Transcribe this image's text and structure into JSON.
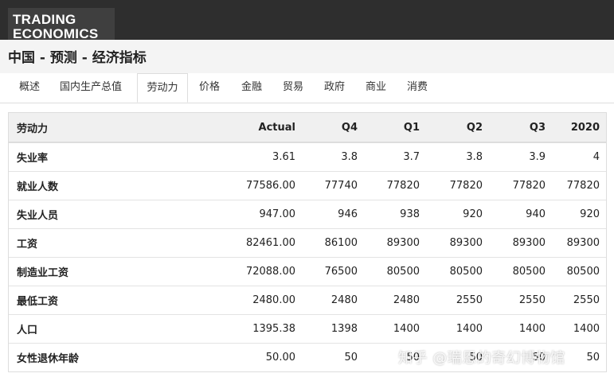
{
  "brand": {
    "line1": "TRADING",
    "line2": "ECONOMICS"
  },
  "page": {
    "title": "中国 - 预测 - 经济指标"
  },
  "tabs": [
    "概述",
    "国内生产总值",
    "劳动力",
    "价格",
    "金融",
    "贸易",
    "政府",
    "商业",
    "消费"
  ],
  "active_tab": "劳动力",
  "table": {
    "headers": [
      "劳动力",
      "Actual",
      "Q4",
      "Q1",
      "Q2",
      "Q3",
      "2020"
    ],
    "rows": [
      [
        "失业率",
        "3.61",
        "3.8",
        "3.7",
        "3.8",
        "3.9",
        "4"
      ],
      [
        "就业人数",
        "77586.00",
        "77740",
        "77820",
        "77820",
        "77820",
        "77820"
      ],
      [
        "失业人员",
        "947.00",
        "946",
        "938",
        "920",
        "940",
        "920"
      ],
      [
        "工资",
        "82461.00",
        "86100",
        "89300",
        "89300",
        "89300",
        "89300"
      ],
      [
        "制造业工资",
        "72088.00",
        "76500",
        "80500",
        "80500",
        "80500",
        "80500"
      ],
      [
        "最低工资",
        "2480.00",
        "2480",
        "2480",
        "2550",
        "2550",
        "2550"
      ],
      [
        "人口",
        "1395.38",
        "1398",
        "1400",
        "1400",
        "1400",
        "1400"
      ],
      [
        "女性退休年龄",
        "50.00",
        "50",
        "50",
        "50",
        "50",
        "50"
      ]
    ]
  },
  "watermark": "知乎 @瑞恩的奇幻博物馆",
  "colors": {
    "topbar": "#2e2e2e",
    "header_bg": "#f0f0f0"
  }
}
